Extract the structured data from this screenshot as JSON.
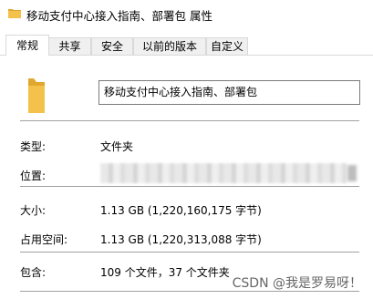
{
  "window": {
    "title": "移动支付中心接入指南、部署包 属性"
  },
  "tabs": [
    {
      "label": "常规",
      "active": true
    },
    {
      "label": "共享",
      "active": false
    },
    {
      "label": "安全",
      "active": false
    },
    {
      "label": "以前的版本",
      "active": false
    },
    {
      "label": "自定义",
      "active": false
    }
  ],
  "general": {
    "folder_name": "移动支付中心接入指南、部署包",
    "type_label": "类型:",
    "type_value": "文件夹",
    "location_label": "位置:",
    "size_label": "大小:",
    "size_value": "1.13 GB (1,220,160,175 字节)",
    "disk_size_label": "占用空间:",
    "disk_size_value": "1.13 GB (1,220,313,088 字节)",
    "contains_label": "包含:",
    "contains_value": "109 个文件，37 个文件夹"
  },
  "watermark": "CSDN @我是罗易呀！",
  "colors": {
    "folder_yellow": "#f4c24b",
    "folder_shadow": "#e0a82e",
    "tab_border": "#d9d9d9"
  }
}
